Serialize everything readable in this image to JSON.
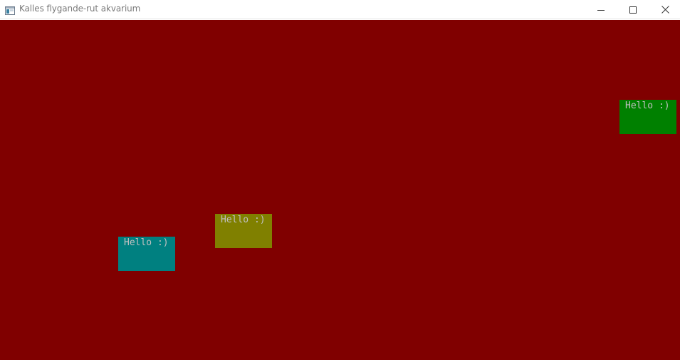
{
  "window": {
    "title": "Kalles flygande-rut akvarium",
    "controls": {
      "minimize_icon": "minimize-icon",
      "maximize_icon": "maximize-icon",
      "close_icon": "close-icon"
    }
  },
  "aquarium": {
    "background_color": "#800000",
    "fish": [
      {
        "label": "Hello :)",
        "color": "#008000",
        "text_color": "#c0c0c0"
      },
      {
        "label": "Hello :)",
        "color": "#808000",
        "text_color": "#c0c0c0"
      },
      {
        "label": "Hello :)",
        "color": "#008080",
        "text_color": "#c0c0c0"
      }
    ]
  }
}
